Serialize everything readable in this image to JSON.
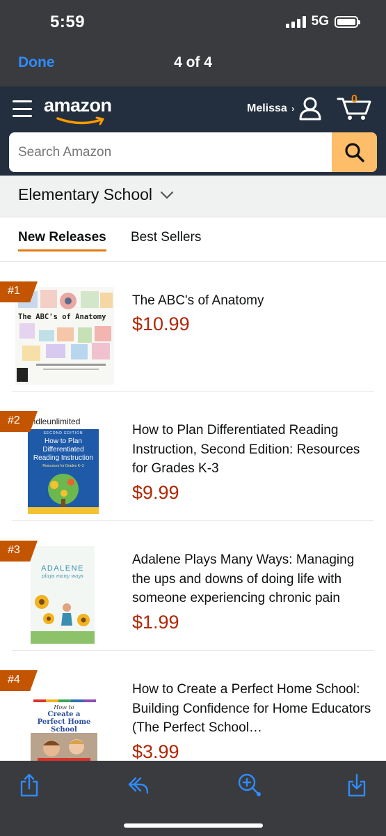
{
  "status_bar": {
    "time": "5:59",
    "network": "5G"
  },
  "viewer": {
    "done_label": "Done",
    "page_indicator": "4 of 4"
  },
  "header": {
    "logo": "amazon",
    "account_name": "Melissa",
    "account_caret": "›",
    "cart_count": "0",
    "search_placeholder": "Search Amazon"
  },
  "category": {
    "title": "Elementary School"
  },
  "tabs": [
    {
      "label": "New Releases",
      "active": true
    },
    {
      "label": "Best Sellers",
      "active": false
    }
  ],
  "products": [
    {
      "rank": "#1",
      "title": "The ABC's of Anatomy",
      "price": "$10.99",
      "cover_text": "The ABC's of Anatomy"
    },
    {
      "rank": "#2",
      "title": "How to Plan Differentiated Reading Instruction, Second Edition: Resources for Grades K-3",
      "price": "$9.99",
      "cover_brand": "kindleunlimited",
      "cover_edition": "SECOND EDITION",
      "cover_title": "How to Plan Differentiated Reading Instruction",
      "cover_subtitle": "Resources for Grades K–3"
    },
    {
      "rank": "#3",
      "title": "Adalene Plays Many Ways: Managing the ups and downs of doing life with someone experiencing chronic pain",
      "price": "$1.99",
      "cover_title": "ADALENE",
      "cover_subtitle": "plays many ways"
    },
    {
      "rank": "#4",
      "title": "How to Create a Perfect Home School: Building Confidence for Home Educators (The Perfect School…",
      "price": "$3.99",
      "cover_small": "How to",
      "cover_title": "Create a Perfect Home School"
    }
  ],
  "colors": {
    "amazon_header": "#232f3e",
    "search_button": "#febd69",
    "price": "#b12704",
    "rank_badge": "#c45500",
    "tab_underline": "#e47911",
    "ios_link": "#2f8cff"
  },
  "icons": [
    "menu-icon",
    "user-icon",
    "cart-icon",
    "search-icon",
    "chevron-down-icon",
    "share-icon",
    "reply-icon",
    "zoom-icon",
    "save-icon"
  ]
}
